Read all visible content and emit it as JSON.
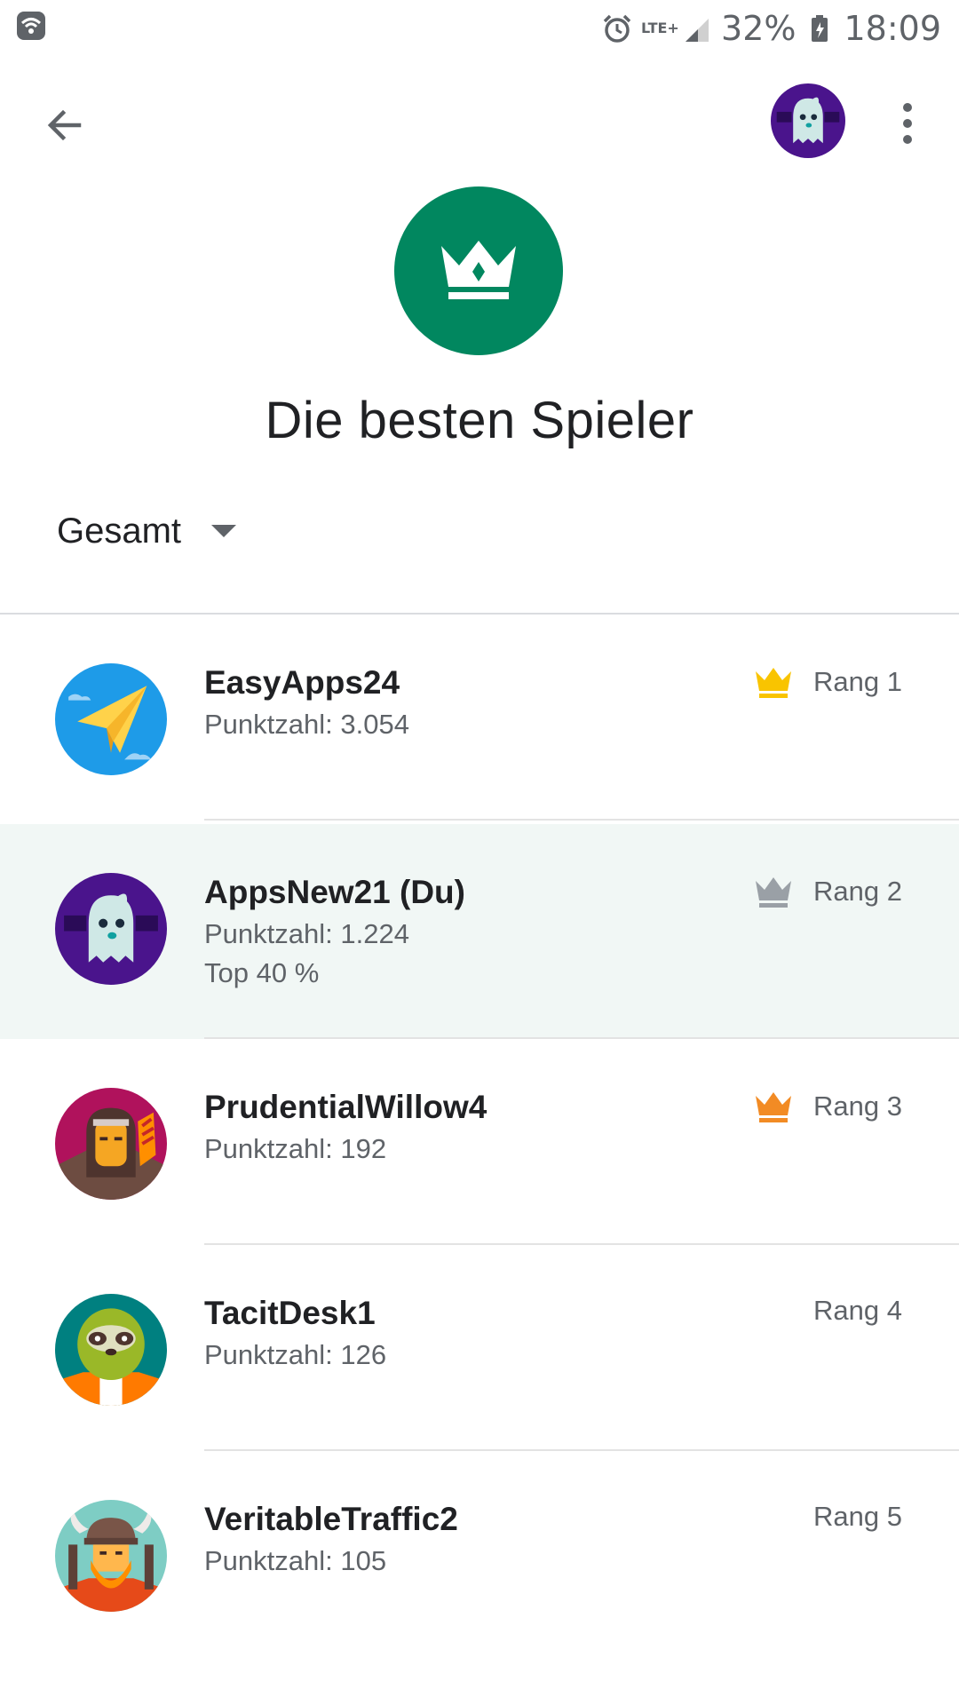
{
  "status_bar": {
    "lte": "LTE+",
    "battery": "32%",
    "time": "18:09"
  },
  "app_bar": {
    "back_icon": "arrow-back-icon",
    "more_icon": "more-vert-icon"
  },
  "header": {
    "icon": "crown-icon",
    "icon_color": "#01875f",
    "title": "Die besten Spieler"
  },
  "filter": {
    "selected": "Gesamt"
  },
  "players": [
    {
      "name": "EasyApps24",
      "score": "Punktzahl: 3.054",
      "extra": "",
      "rank": "Rang 1",
      "crown_color": "#f9c400",
      "avatar": "paper-plane-avatar"
    },
    {
      "name": "AppsNew21 (Du)",
      "score": "Punktzahl: 1.224",
      "extra": "Top 40 %",
      "rank": "Rang 2",
      "crown_color": "#9aa0a6",
      "avatar": "ghost-avatar"
    },
    {
      "name": "PrudentialWillow4",
      "score": "Punktzahl: 192",
      "extra": "",
      "rank": "Rang 3",
      "crown_color": "#f28b24",
      "avatar": "archer-avatar"
    },
    {
      "name": "TacitDesk1",
      "score": "Punktzahl: 126",
      "extra": "",
      "rank": "Rang 4",
      "crown_color": "",
      "avatar": "sloth-avatar"
    },
    {
      "name": "VeritableTraffic2",
      "score": "Punktzahl: 105",
      "extra": "",
      "rank": "Rang 5",
      "crown_color": "",
      "avatar": "viking-avatar"
    }
  ]
}
